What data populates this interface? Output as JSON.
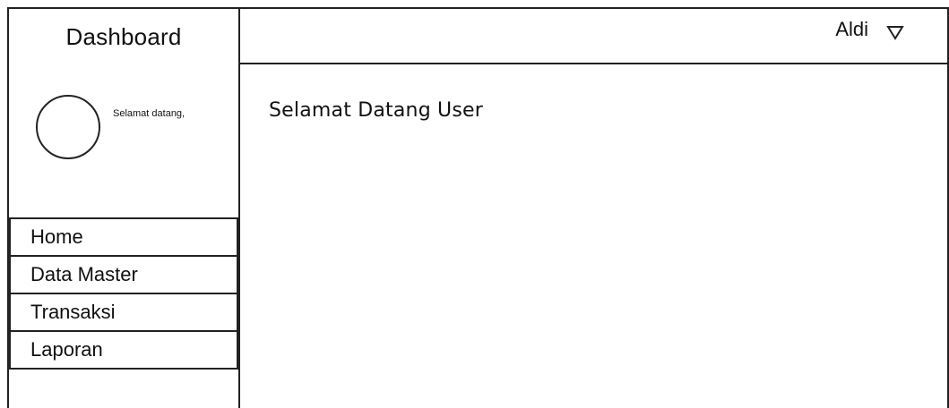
{
  "sidebar": {
    "title": "Dashboard",
    "avatar_icon": "user-avatar-circle-icon",
    "greeting": "Selamat datang,",
    "items": [
      {
        "label": "Home"
      },
      {
        "label": "Data Master"
      },
      {
        "label": "Transaksi"
      },
      {
        "label": "Laporan"
      }
    ]
  },
  "header": {
    "user_name": "Aldi",
    "dropdown_icon": "chevron-down-icon"
  },
  "main": {
    "welcome_text": "Selamat Datang User"
  }
}
